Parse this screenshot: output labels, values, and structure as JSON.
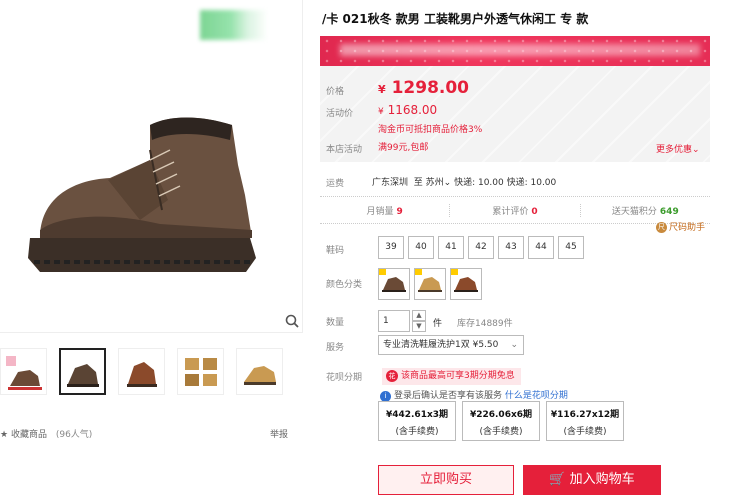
{
  "title": "/卡  021秋冬   款男   工装靴男户外透气休闲工   专   款",
  "price": {
    "label": "价格",
    "currency": "¥",
    "value": "1298.00"
  },
  "promo": {
    "label": "活动价",
    "currency": "¥",
    "value": "1168.00",
    "coin_note": "淘金币可抵扣商品价格3%"
  },
  "shop_promo": {
    "label": "本店活动",
    "value": "满99元,包邮",
    "more": "更多优惠"
  },
  "shipping": {
    "label": "运费",
    "from": "广东深圳",
    "to_word": "至",
    "to": "苏州",
    "detail": "快递: 10.00 快递: 10.00"
  },
  "stats": {
    "monthly_label": "月销量",
    "monthly": "9",
    "reviews_label": "累计评价",
    "reviews": "0",
    "points_label": "送天猫积分",
    "points": "649"
  },
  "size_guide": "尺码助手",
  "size_label": "鞋码",
  "sizes": [
    "39",
    "40",
    "41",
    "42",
    "43",
    "44",
    "45"
  ],
  "color_label": "颜色分类",
  "colors": [
    {
      "name": "color-brown",
      "hex": "#6a4a36"
    },
    {
      "name": "color-tan",
      "hex": "#c99a52"
    },
    {
      "name": "color-rust",
      "hex": "#8b4a2b"
    }
  ],
  "qty": {
    "label": "数量",
    "value": "1",
    "unit": "件",
    "stock": "库存14889件"
  },
  "service": {
    "label": "服务",
    "value": "专业清洗鞋履洗护1双 ¥5.50"
  },
  "installment": {
    "label": "花呗分期",
    "note": "该商品最高可享3期分期免息",
    "info": "登录后确认是否享有该服务",
    "link": "什么是花呗分期",
    "plans": [
      {
        "amount": "¥442.61x3期",
        "fee": "(含手续费)"
      },
      {
        "amount": "¥226.06x6期",
        "fee": "(含手续费)"
      },
      {
        "amount": "¥116.27x12期",
        "fee": "(含手续费)"
      }
    ]
  },
  "buttons": {
    "buy": "立即购买",
    "cart": "加入购物车"
  },
  "gallery": {
    "favorite": "收藏商品",
    "fav_count": "(96人气)",
    "report": "举报"
  }
}
